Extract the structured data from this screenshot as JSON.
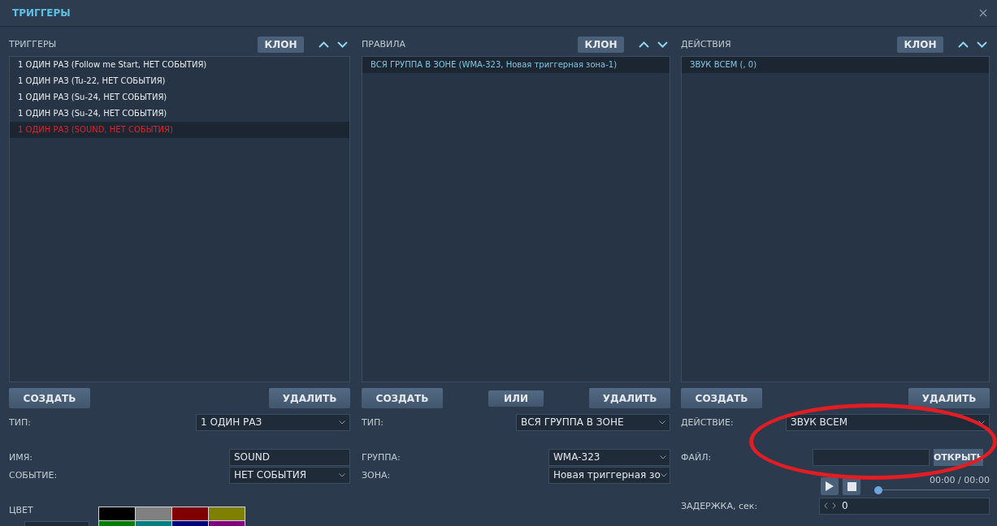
{
  "window": {
    "title": "ТРИГГЕРЫ",
    "annotation_ellipse": true
  },
  "columns": [
    {
      "title": "ТРИГГЕРЫ",
      "clone": "КЛОН",
      "items": [
        {
          "text": "1 ОДИН РАЗ (Follow me Start, НЕТ СОБЫТИЯ)",
          "selected": false,
          "color": "#e8ecef"
        },
        {
          "text": "1 ОДИН РАЗ (Tu-22, НЕТ СОБЫТИЯ)",
          "selected": false,
          "color": "#e8ecef"
        },
        {
          "text": "1 ОДИН РАЗ (Su-24, НЕТ СОБЫТИЯ)",
          "selected": false,
          "color": "#e8ecef"
        },
        {
          "text": "1 ОДИН РАЗ (Su-24, НЕТ СОБЫТИЯ)",
          "selected": false,
          "color": "#e8ecef"
        },
        {
          "text": "1 ОДИН РАЗ (SOUND, НЕТ СОБЫТИЯ)",
          "selected": true,
          "color": "#e0222a"
        }
      ],
      "buttons": [
        "СОЗДАТЬ",
        "УДАЛИТЬ"
      ],
      "groups": [
        [
          {
            "kind": "select",
            "label": "ТИП:",
            "value": "1 ОДИН РАЗ"
          }
        ],
        [
          {
            "kind": "text",
            "label": "ИМЯ:",
            "value": "SOUND"
          },
          {
            "kind": "select",
            "label": "СОБЫТИЕ:",
            "value": "НЕТ СОБЫТИЯ"
          }
        ],
        [
          {
            "kind": "colors",
            "label": "ЦВЕТ",
            "swatches": [
              {
                "color": "#000000"
              },
              {
                "color": "#808080"
              },
              {
                "color": "#800000"
              },
              {
                "color": "#808000"
              },
              {
                "color": "#008000"
              },
              {
                "color": "#008080"
              },
              {
                "color": "#000080"
              },
              {
                "color": "#800080"
              }
            ]
          }
        ]
      ]
    },
    {
      "title": "ПРАВИЛА",
      "clone": "КЛОН",
      "items": [
        {
          "text": "ВСЯ ГРУППА В ЗОНЕ (WMA-323, Новая триггерная зона-1)",
          "selected": true,
          "color": "#7fc6e0"
        }
      ],
      "buttons": [
        "СОЗДАТЬ",
        "ИЛИ",
        "УДАЛИТЬ"
      ],
      "groups": [
        [
          {
            "kind": "select",
            "label": "ТИП:",
            "value": "ВСЯ ГРУППА В ЗОНЕ"
          }
        ],
        [
          {
            "kind": "select",
            "label": "ГРУППА:",
            "value": "WMA-323"
          },
          {
            "kind": "select",
            "label": "ЗОНА:",
            "value": "Новая триггерная зо"
          }
        ]
      ]
    },
    {
      "title": "ДЕЙСТВИЯ",
      "clone": "КЛОН",
      "items": [
        {
          "text": "ЗВУК ВСЕМ (, 0)",
          "selected": true,
          "color": "#7fc6e0"
        }
      ],
      "buttons": [
        "СОЗДАТЬ",
        "УДАЛИТЬ"
      ],
      "groups": [
        [
          {
            "kind": "select",
            "label": "ДЕЙСТВИЕ:",
            "value": "ЗВУК ВСЕМ"
          }
        ],
        [
          {
            "kind": "file",
            "label": "ФАЙЛ:",
            "button": "ОТКРЫТЬ"
          },
          {
            "kind": "media",
            "time": "00:00 / 00:00",
            "level": 0
          }
        ],
        [
          {
            "kind": "spinner",
            "label": "ЗАДЕРЖКА, сек:",
            "value": "0"
          }
        ]
      ]
    }
  ]
}
